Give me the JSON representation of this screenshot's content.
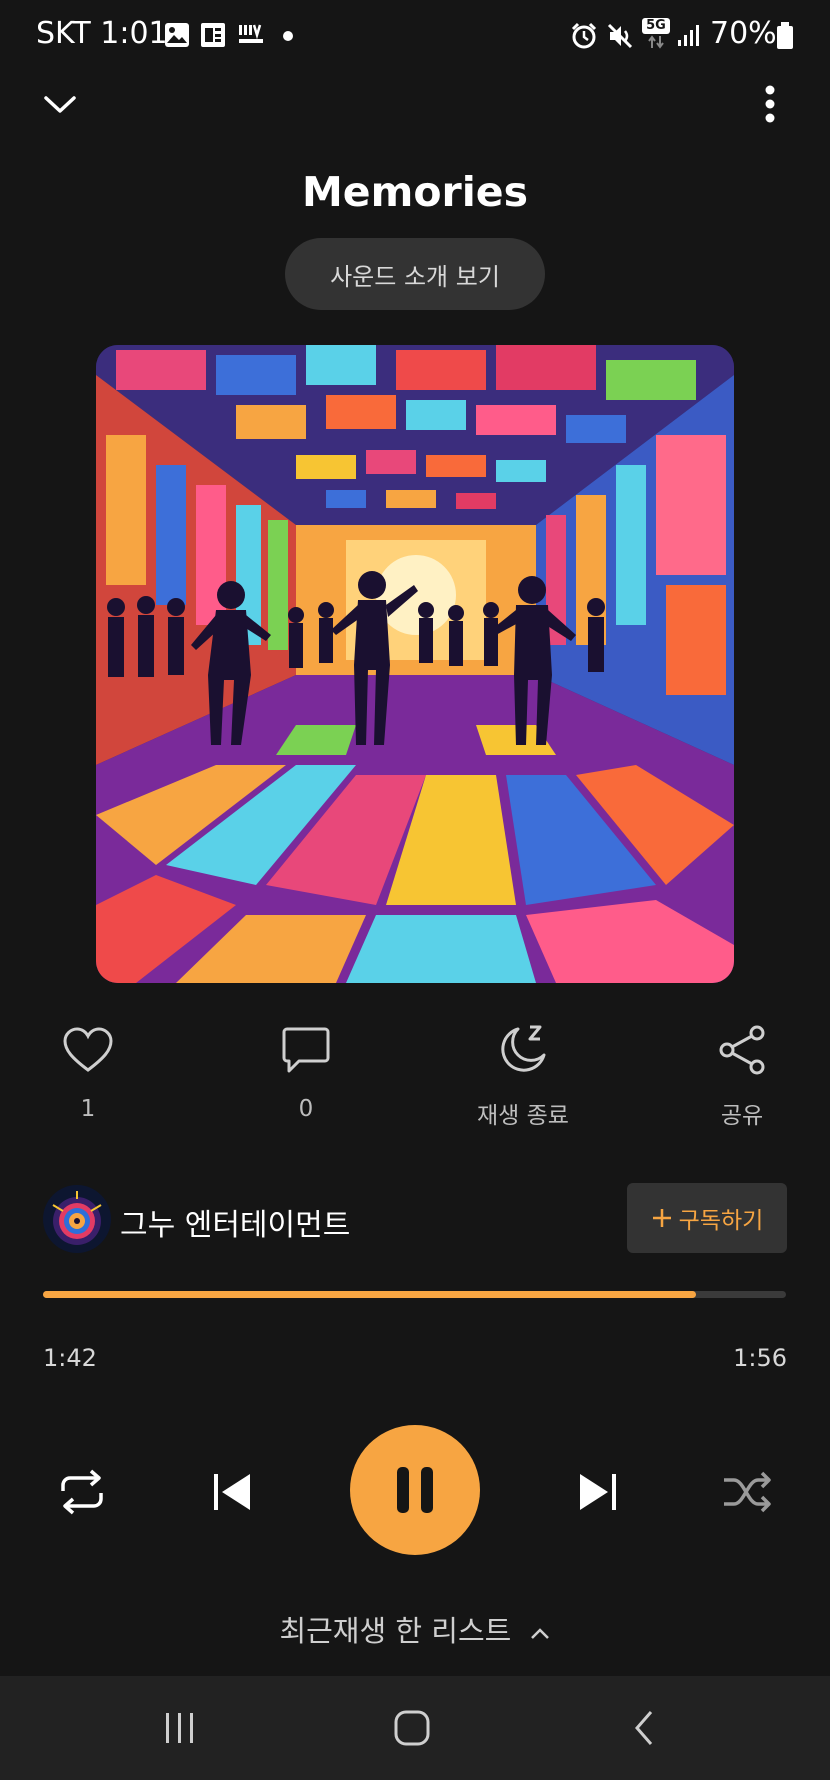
{
  "status_bar": {
    "carrier_time": "SKT 1:01",
    "network": "5G",
    "battery": "70%",
    "icons": [
      "gallery-icon",
      "news-icon",
      "liiv-next-icon",
      "dot-icon",
      "alarm-icon",
      "mute-icon",
      "signal-icon",
      "battery-icon"
    ]
  },
  "header": {
    "collapse_icon": "chevron-down-icon",
    "more_icon": "more-vertical-icon"
  },
  "track": {
    "title": "Memories",
    "sound_intro_label": "사운드 소개 보기"
  },
  "actions": {
    "like_count": "1",
    "comment_count": "0",
    "sleep_label": "재생 종료",
    "share_label": "공유"
  },
  "channel": {
    "name": "그누 엔터테이먼트",
    "subscribe_label": "구독하기",
    "subscribe_icon": "plus-icon"
  },
  "progress": {
    "current": "1:42",
    "total": "1:56",
    "fraction": 0.8793
  },
  "controls": [
    "repeat-icon",
    "previous-icon",
    "pause-icon",
    "next-icon",
    "shuffle-icon"
  ],
  "playlist": {
    "label": "최근재생 한 리스트"
  },
  "nav": [
    "recent-apps-icon",
    "home-icon",
    "back-icon"
  ],
  "colors": {
    "accent": "#F7A542",
    "background": "#151515",
    "pill": "#333333",
    "nav": "#222222"
  }
}
